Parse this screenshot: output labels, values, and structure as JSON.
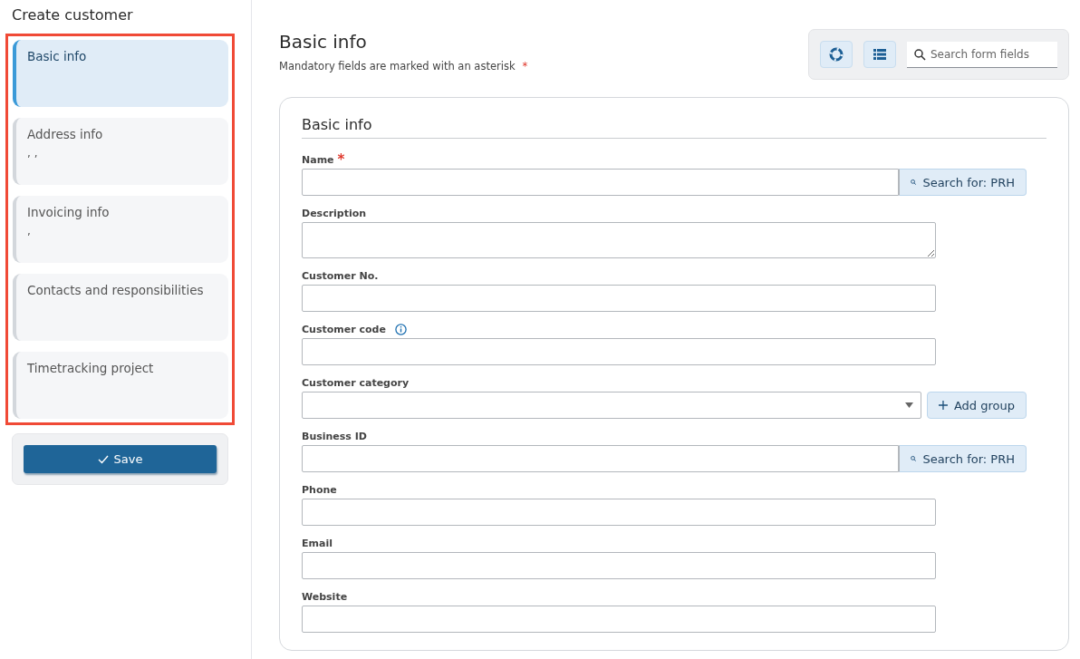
{
  "page_title": "Create customer",
  "steps": [
    {
      "label": "Basic info",
      "selected": true
    },
    {
      "label": "Address info",
      "detail": ", ,",
      "selected": false
    },
    {
      "label": "Invoicing info",
      "detail": ",",
      "selected": false
    },
    {
      "label": "Contacts and responsibilities",
      "selected": false
    },
    {
      "label": "Timetracking project",
      "selected": false
    }
  ],
  "save_button": "Save",
  "header": {
    "title": "Basic info",
    "subtitle": "Mandatory fields are marked with an asterisk",
    "asterisk": "*",
    "search": {
      "placeholder": "Search form fields"
    }
  },
  "section": {
    "title": "Basic info",
    "required_mark": "*",
    "fields": [
      {
        "label": "Name",
        "kind": "lookup",
        "required": true,
        "info": false,
        "button": "Search for: PRH"
      },
      {
        "label": "Description",
        "kind": "textarea",
        "required": false,
        "info": false
      },
      {
        "label": "Customer No.",
        "kind": "text",
        "required": false,
        "info": false
      },
      {
        "label": "Customer code",
        "kind": "text",
        "required": false,
        "info": true
      },
      {
        "label": "Customer category",
        "kind": "select",
        "required": false,
        "info": false,
        "button": "Add group"
      },
      {
        "label": "Business ID",
        "kind": "lookup",
        "required": false,
        "info": false,
        "button": "Search for: PRH"
      },
      {
        "label": "Phone",
        "kind": "text",
        "required": false,
        "info": false
      },
      {
        "label": "Email",
        "kind": "text",
        "required": false,
        "info": false
      },
      {
        "label": "Website",
        "kind": "text",
        "required": false,
        "info": false
      }
    ]
  }
}
